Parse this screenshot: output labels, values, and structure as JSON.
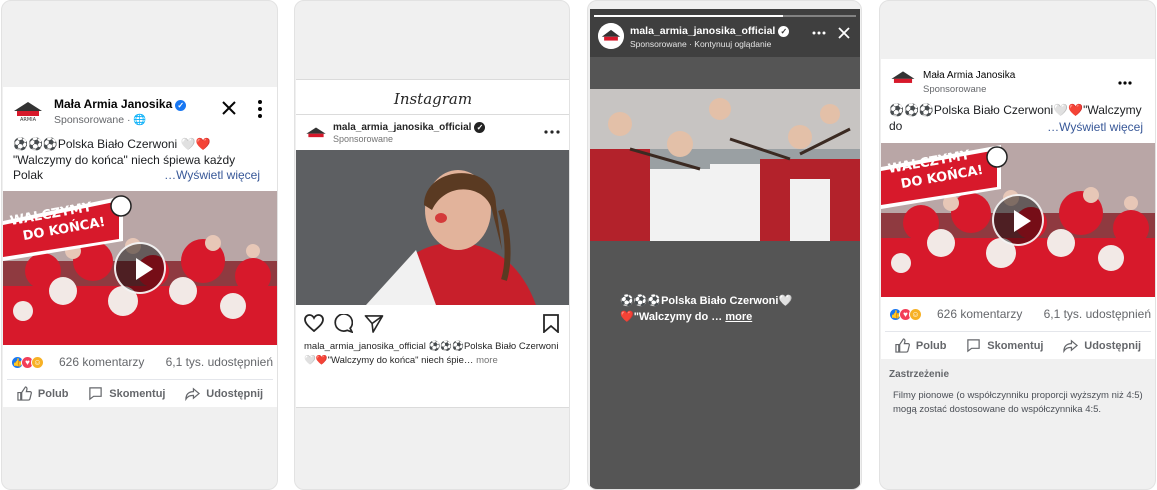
{
  "accent_color": "#1877f2",
  "brand_red": "#d7192b",
  "panel_feed": {
    "page_name": "Mała Armia Janosika",
    "sponsored": "Sponsorowane",
    "text": "⚽⚽⚽Polska Biało Czerwoni 🤍❤️ \"Walczymy do końca\" niech śpiewa każdy Polak",
    "see_more": "…Wyświetl więcej",
    "overlay_line1": "WALCZYMY",
    "overlay_line2": "DO KOŃCA!",
    "comments": "626 komentarzy",
    "shares": "6,1 tys. udostępnień",
    "like": "Polub",
    "comment": "Skomentuj",
    "share": "Udostępnij"
  },
  "panel_instagram": {
    "brand": "Instagram",
    "username": "mala_armia_janosika_official",
    "sponsored": "Sponsorowane",
    "caption_user": "mala_armia_janosika_official",
    "caption_text": "⚽⚽⚽Polska Biało Czerwoni 🤍❤️\"Walczymy do końca\" niech śpie…",
    "more": "more"
  },
  "panel_story": {
    "username": "mala_armia_janosika_official",
    "sponsored": "Sponsorowane",
    "continue": "Kontynuuj oglądanie",
    "text": "⚽⚽⚽Polska Biało Czerwoni🤍❤️\"Walczymy do …",
    "more": "more",
    "progress": 0.72
  },
  "panel_mobile": {
    "page_name": "Mała Armia Janosika",
    "sponsored": "Sponsorowane",
    "text": "⚽⚽⚽Polska Biało Czerwoni🤍❤️\"Walczymy do",
    "see_more": "…Wyświetl więcej",
    "overlay_line1": "WALCZYMY",
    "overlay_line2": "DO KOŃCA!",
    "comments": "626 komentarzy",
    "shares": "6,1 tys. udostępnień",
    "like": "Polub",
    "comment": "Skomentuj",
    "share": "Udostępnij",
    "disclaimer_title": "Zastrzeżenie",
    "disclaimer_text": "Filmy pionowe (o współczynniku proporcji wyższym niż 4:5) mogą zostać dostosowane do współczynnika 4:5."
  }
}
